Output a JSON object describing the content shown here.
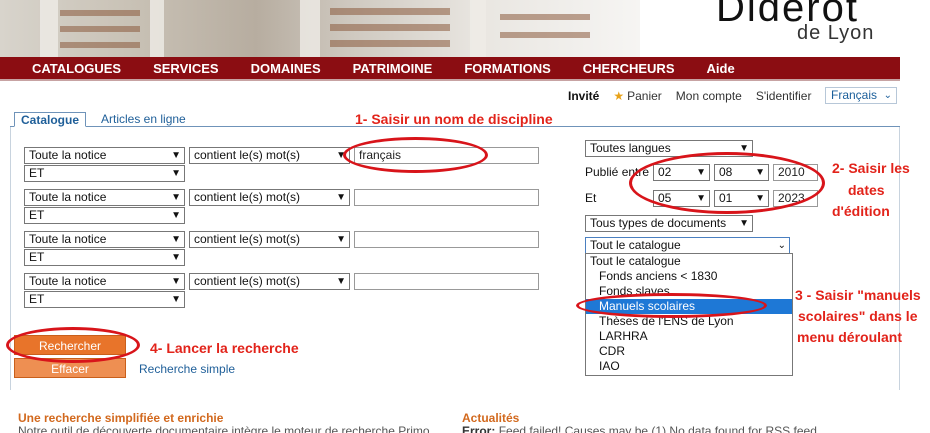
{
  "header": {
    "logo_main": "Diderot",
    "logo_sub": "de Lyon"
  },
  "nav": [
    "CATALOGUES",
    "SERVICES",
    "DOMAINES",
    "PATRIMOINE",
    "FORMATIONS",
    "CHERCHEURS",
    "Aide"
  ],
  "userbar": {
    "invite": "Invité",
    "panier": "Panier",
    "compte": "Mon compte",
    "identifier": "S'identifier",
    "language": "Français"
  },
  "tabs": {
    "active": "Catalogue",
    "other": "Articles en ligne"
  },
  "rows": [
    {
      "field": "Toute la notice",
      "op": "contient le(s) mot(s)",
      "value": "français",
      "bool": "ET"
    },
    {
      "field": "Toute la notice",
      "op": "contient le(s) mot(s)",
      "value": "",
      "bool": "ET"
    },
    {
      "field": "Toute la notice",
      "op": "contient le(s) mot(s)",
      "value": "",
      "bool": "ET"
    },
    {
      "field": "Toute la notice",
      "op": "contient le(s) mot(s)",
      "value": "",
      "bool": "ET"
    }
  ],
  "filters": {
    "langues": "Toutes langues",
    "publie_label": "Publié entre",
    "from": {
      "day": "02",
      "month": "08",
      "year": "2010"
    },
    "et_label": "Et",
    "to": {
      "day": "05",
      "month": "01",
      "year": "2023"
    },
    "types": "Tous types de documents",
    "catalogue": "Tout le catalogue"
  },
  "catalogue_options": [
    "Tout le catalogue",
    "Fonds anciens < 1830",
    "Fonds slaves",
    "Manuels scolaires",
    "Thèses de l'ENS de Lyon",
    "LARHRA",
    "CDR",
    "IAO"
  ],
  "catalogue_highlighted": "Manuels scolaires",
  "buttons": {
    "search": "Rechercher",
    "clear": "Effacer",
    "simple": "Recherche simple"
  },
  "annotations": {
    "a1": "1- Saisir un nom de discipline",
    "a2_1": "2- Saisir les",
    "a2_2": "dates",
    "a2_3": "d'édition",
    "a3_1": "3 - Saisir \"manuels",
    "a3_2": "scolaires\" dans le",
    "a3_3": "menu déroulant",
    "a4": "4- Lancer la recherche"
  },
  "bottom": {
    "left_title": "Une recherche simplifiée et enrichie",
    "left_text": "Notre outil de découverte documentaire intègre le moteur de recherche Primo",
    "right_title": "Actualités",
    "right_error_label": "Error:",
    "right_text": "Feed failed! Causes may be (1) No data found for RSS feed"
  },
  "colors": {
    "nav_bg": "#8b0d12",
    "accent_orange": "#e8742a",
    "annotation_red": "#e2231a",
    "link_blue": "#1f5f99",
    "highlight": "#1e78d6"
  }
}
